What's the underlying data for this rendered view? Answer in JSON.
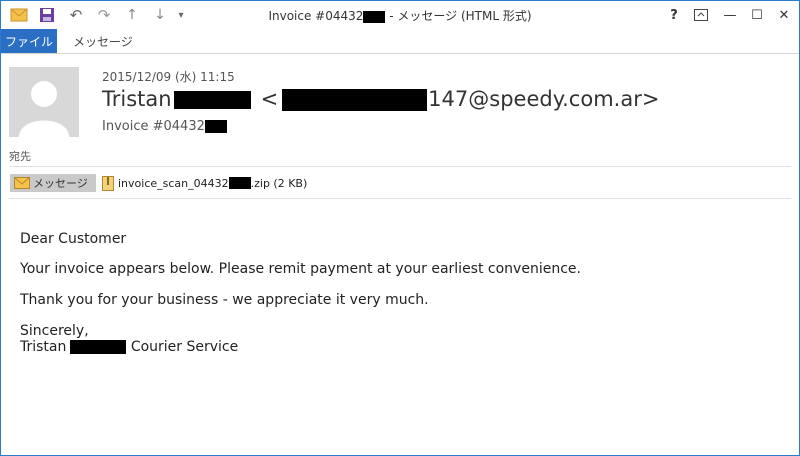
{
  "window": {
    "title_prefix": "Invoice #04432",
    "title_suffix": " - メッセージ (HTML 形式)"
  },
  "window_controls": {
    "help": "?",
    "min": "—",
    "max": "☐",
    "close": "✕"
  },
  "ribbon": {
    "tabs": [
      "ファイル",
      "メッセージ"
    ]
  },
  "header": {
    "date": "2015/12/09 (水) 11:15",
    "sender_first": "Tristan",
    "email_open": "<",
    "email_tail": "147@speedy.com.ar>",
    "subject_prefix": "Invoice #04432",
    "to_label": "宛先"
  },
  "attachments": {
    "message_label": "メッセージ",
    "file_prefix": "invoice_scan_04432",
    "file_suffix": ".zip (2 KB)"
  },
  "body": {
    "greeting": "Dear Customer",
    "p1": "Your invoice appears below. Please remit payment at your earliest convenience.",
    "p2": "Thank you for your business - we appreciate it very much.",
    "closing": "Sincerely,",
    "sig_first": "Tristan",
    "sig_suffix": " Courier Service"
  },
  "colors": {
    "accent": "#2b6fc4",
    "border": "#2b7bd0",
    "redaction": "#000000"
  }
}
